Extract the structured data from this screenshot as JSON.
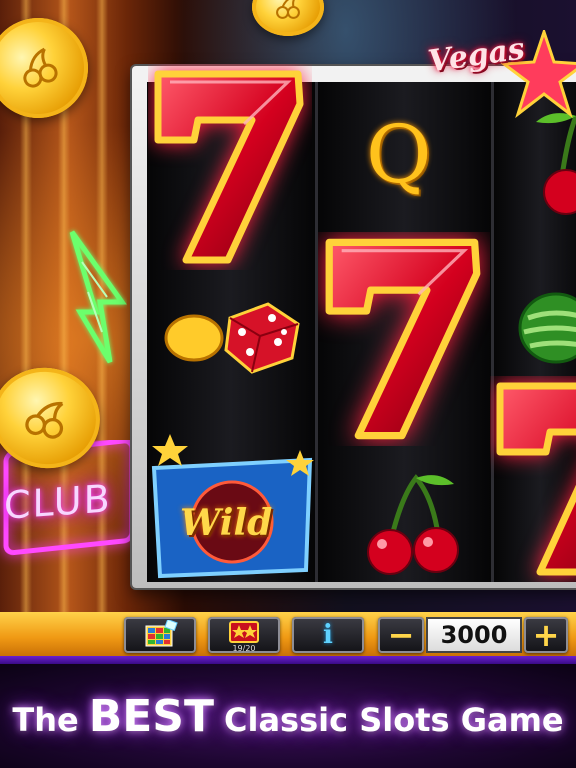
{
  "logo": {
    "text": "Vegas"
  },
  "neon_sign": {
    "text": "CLUB"
  },
  "reels": {
    "symbols": [
      {
        "reel": 1,
        "name": "seven"
      },
      {
        "reel": 1,
        "name": "dice"
      },
      {
        "reel": 1,
        "name": "wild"
      },
      {
        "reel": 2,
        "name": "queen"
      },
      {
        "reel": 2,
        "name": "seven"
      },
      {
        "reel": 2,
        "name": "cherry"
      },
      {
        "reel": 3,
        "name": "cherry"
      },
      {
        "reel": 3,
        "name": "watermelon"
      },
      {
        "reel": 3,
        "name": "seven"
      }
    ],
    "wild_label": "Wild",
    "queen_label": "Q"
  },
  "toolbar": {
    "paytable_icon": "grid-icon",
    "progress": {
      "icon": "star-chest-icon",
      "label": "19/20",
      "current": 19,
      "total": 20
    },
    "info_label": "i",
    "minus_label": "−",
    "bet_value": "3000",
    "plus_label": "+"
  },
  "tagline": {
    "prefix": "The",
    "highlight": "BEST",
    "suffix": "Classic Slots Game"
  },
  "colors": {
    "accent_gold": "#f5b315",
    "seven_red": "#d4001e",
    "neon_purple": "#b537f2",
    "bar_orange": "#f09a14"
  }
}
